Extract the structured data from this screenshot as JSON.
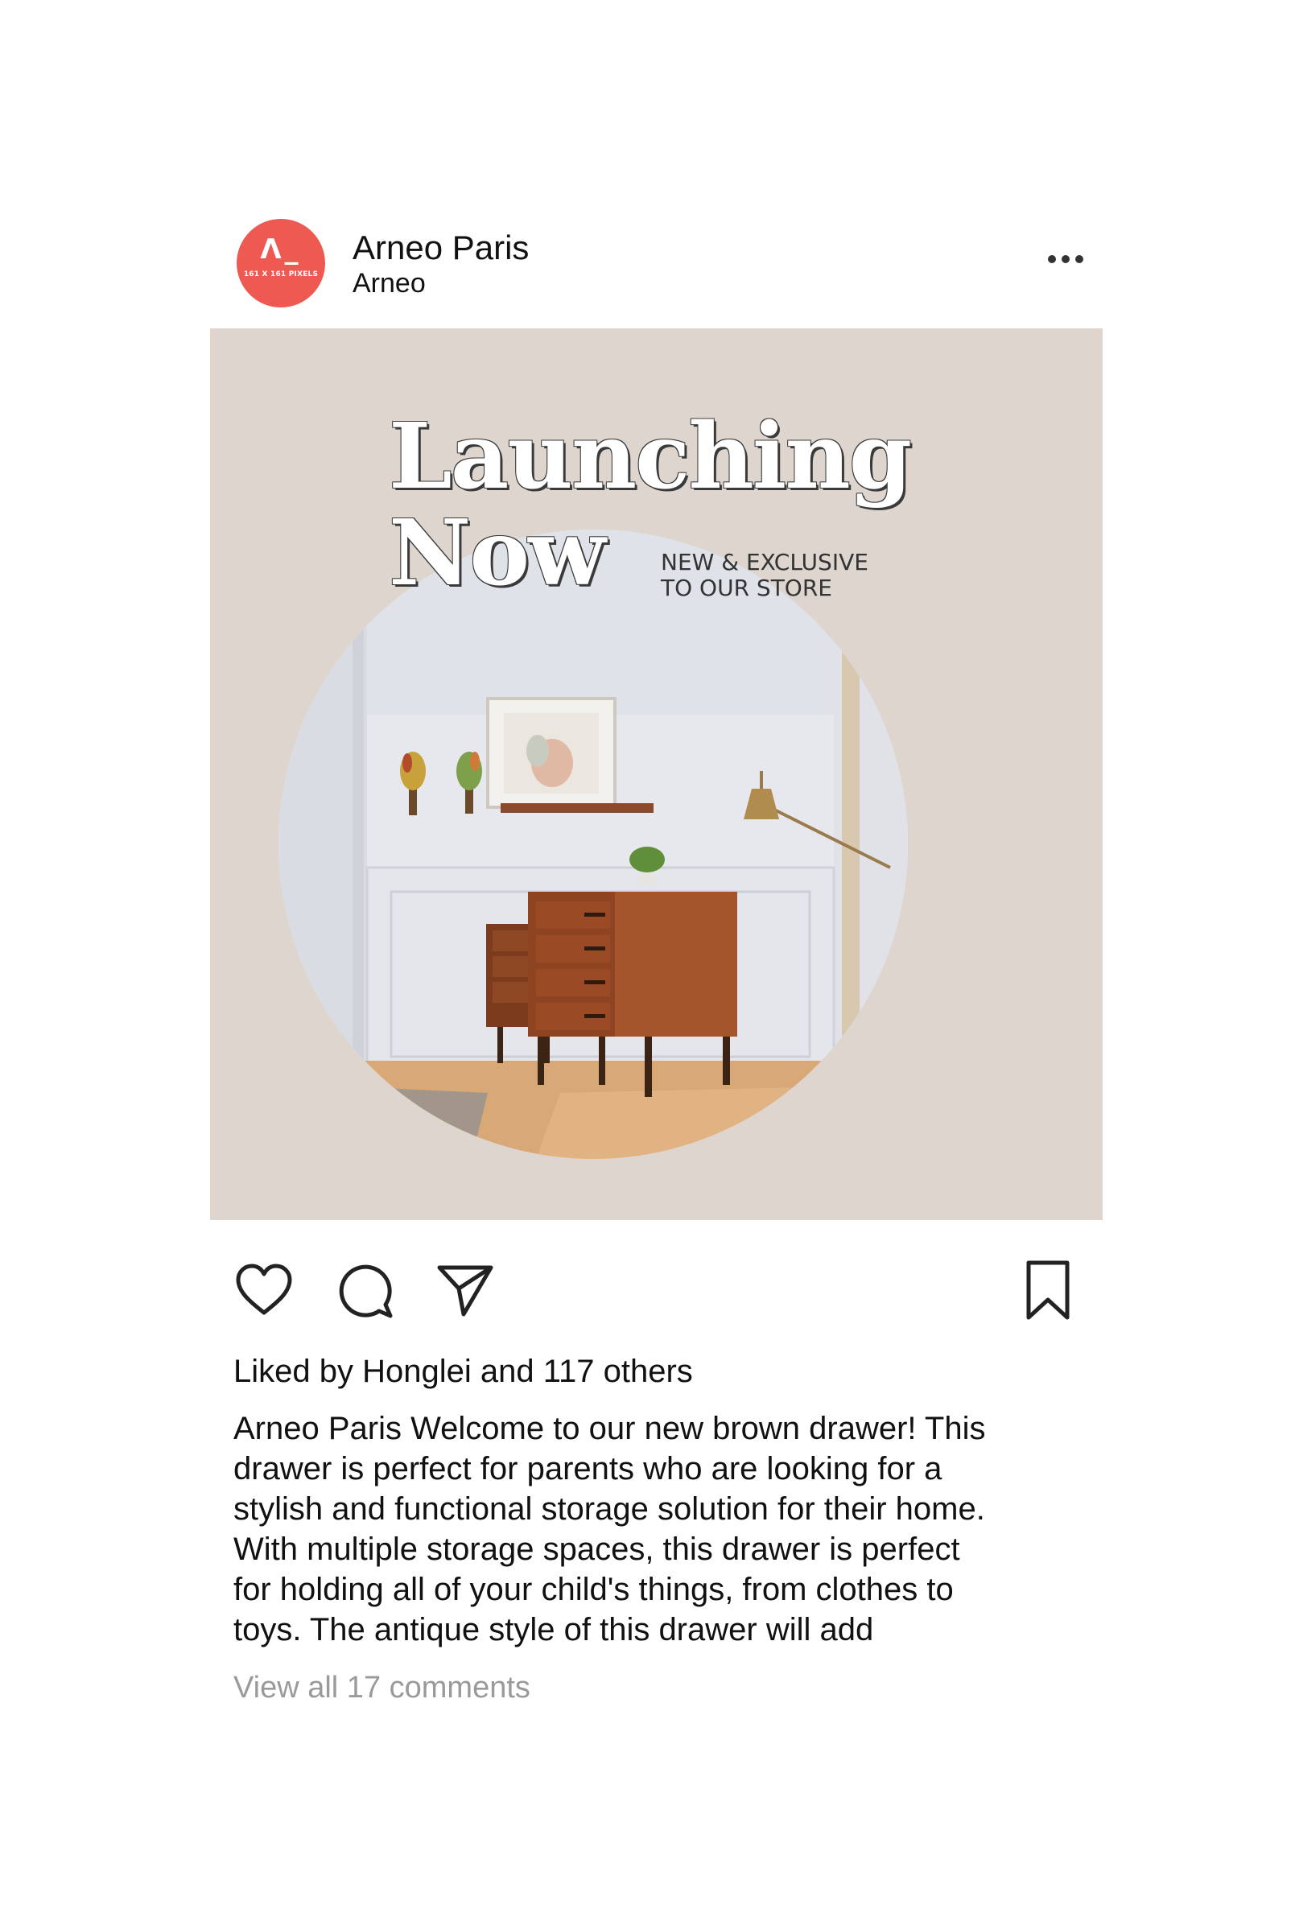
{
  "header": {
    "account_name": "Arneo Paris",
    "account_handle": "Arneo",
    "avatar": {
      "mark": "Λ_",
      "caption": "161 X 161 PIXELS",
      "color": "#ee5a52"
    },
    "more_icon": "more-horizontal-icon"
  },
  "post_image": {
    "title_line1": "Launching",
    "title_line2": "Now",
    "subtitle_line1": "NEW & EXCLUSIVE",
    "subtitle_line2": "TO OUR STORE",
    "background_color": "#ddd5ce"
  },
  "actions": {
    "like_icon": "heart-icon",
    "comment_icon": "comment-icon",
    "share_icon": "send-icon",
    "save_icon": "bookmark-icon"
  },
  "likes_text": "Liked by Honglei and 117 others",
  "caption_lines": [
    "Arneo Paris Welcome to our new brown drawer! This",
    "drawer is perfect for parents who are looking for a",
    "stylish and functional storage solution for their home.",
    "With multiple storage spaces, this drawer is perfect",
    "for holding all of your child's things, from clothes to",
    "toys. The antique style of this drawer will add"
  ],
  "view_comments_text": "View all 17 comments"
}
